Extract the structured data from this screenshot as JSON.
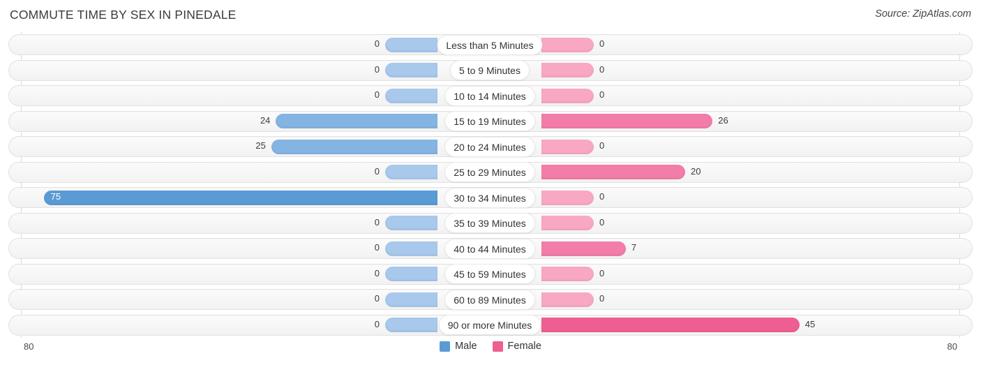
{
  "header": {
    "title": "COMMUTE TIME BY SEX IN PINEDALE",
    "source": "Source: ZipAtlas.com"
  },
  "legend": {
    "items": [
      {
        "label": "Male",
        "color": "#5b9bd5"
      },
      {
        "label": "Female",
        "color": "#ef5e92"
      }
    ]
  },
  "axis": {
    "left_label": "80",
    "right_label": "80"
  },
  "colors": {
    "male_strong": "#5b9bd5",
    "male_mid": "#84b4e2",
    "male_light": "#a8c8ec",
    "female_strong": "#ef5e92",
    "female_mid": "#f27da8",
    "female_light": "#f9a8c4",
    "track": "#f6f6f6",
    "gridline": "#d8d8d8"
  },
  "chart_data": {
    "type": "bar",
    "title": "COMMUTE TIME BY SEX IN PINEDALE",
    "subtitle": "",
    "xlabel": "",
    "ylabel": "",
    "orientation": "horizontal-diverging",
    "grid": true,
    "legend_position": "bottom-center",
    "xlim": [
      -80,
      80
    ],
    "axis_max": 80,
    "categories": [
      "Less than 5 Minutes",
      "5 to 9 Minutes",
      "10 to 14 Minutes",
      "15 to 19 Minutes",
      "20 to 24 Minutes",
      "25 to 29 Minutes",
      "30 to 34 Minutes",
      "35 to 39 Minutes",
      "40 to 44 Minutes",
      "45 to 59 Minutes",
      "60 to 89 Minutes",
      "90 or more Minutes"
    ],
    "series": [
      {
        "name": "Male",
        "color": "#5b9bd5",
        "side": "left",
        "values": [
          0,
          0,
          0,
          24,
          25,
          0,
          75,
          0,
          0,
          0,
          0,
          0
        ]
      },
      {
        "name": "Female",
        "color": "#ef5e92",
        "side": "right",
        "values": [
          0,
          0,
          0,
          26,
          0,
          20,
          0,
          0,
          7,
          0,
          0,
          45
        ]
      }
    ]
  },
  "rows": [
    {
      "label": "Less than 5 Minutes",
      "male": "0",
      "female": "0"
    },
    {
      "label": "5 to 9 Minutes",
      "male": "0",
      "female": "0"
    },
    {
      "label": "10 to 14 Minutes",
      "male": "0",
      "female": "0"
    },
    {
      "label": "15 to 19 Minutes",
      "male": "24",
      "female": "26"
    },
    {
      "label": "20 to 24 Minutes",
      "male": "25",
      "female": "0"
    },
    {
      "label": "25 to 29 Minutes",
      "male": "0",
      "female": "20"
    },
    {
      "label": "30 to 34 Minutes",
      "male": "75",
      "female": "0"
    },
    {
      "label": "35 to 39 Minutes",
      "male": "0",
      "female": "0"
    },
    {
      "label": "40 to 44 Minutes",
      "male": "0",
      "female": "7"
    },
    {
      "label": "45 to 59 Minutes",
      "male": "0",
      "female": "0"
    },
    {
      "label": "60 to 89 Minutes",
      "male": "0",
      "female": "0"
    },
    {
      "label": "90 or more Minutes",
      "male": "0",
      "female": "45"
    }
  ]
}
